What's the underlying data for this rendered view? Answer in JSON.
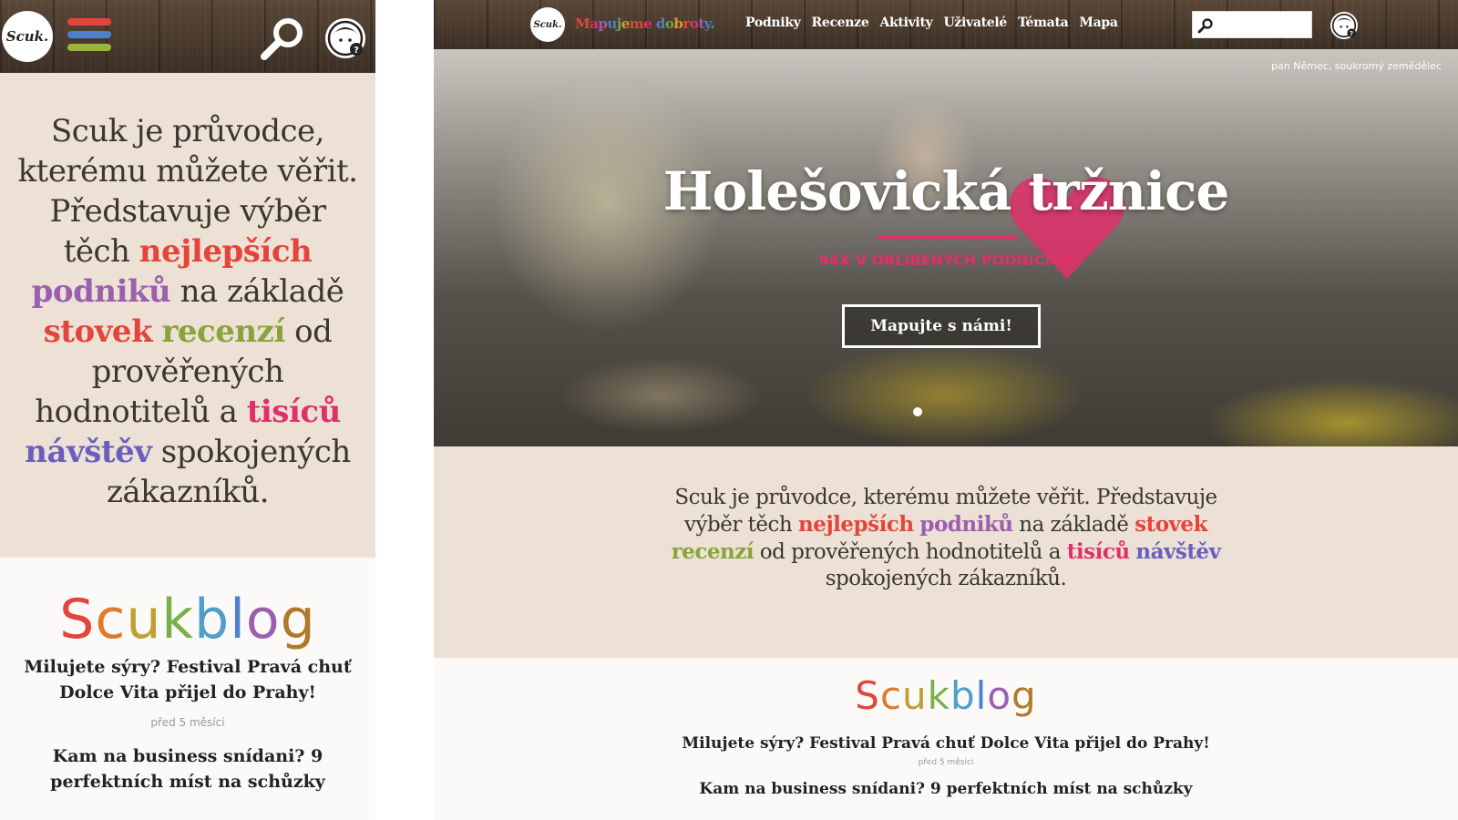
{
  "brand": {
    "logo_text": "Scuk.",
    "tagline": "Mapujeme dobroty.",
    "tagline_colors": [
      "#e4453a",
      "#e0306a",
      "#9b5fb0",
      "#4f7fc8",
      "#6aa84f",
      "#e09a2a"
    ]
  },
  "colors": {
    "intro_bg": "#ece1d4",
    "header_wood": "#4a3a2e",
    "accent_pink": "#e0306a",
    "burger": [
      "#e4453a",
      "#4f7fc8",
      "#9ab53a"
    ]
  },
  "nav": {
    "items": [
      "Podniky",
      "Recenze",
      "Aktivity",
      "Uživatelé",
      "Témata",
      "Mapa"
    ]
  },
  "search": {
    "icon": "magnifier-icon",
    "value": ""
  },
  "help": {
    "icon": "avatar-help-icon"
  },
  "mobile_menu": {
    "icon": "hamburger-menu-icon"
  },
  "hero": {
    "credit": "pan Němec, soukromý zemědělec",
    "title": "Holešovická tržnice",
    "subtitle": "94X V OBLÍBENÝCH PODNICÍCH",
    "button": "Mapujte s námi!",
    "heart_icon": "heart-icon"
  },
  "intro": {
    "text_start": "Scuk je průvodce, kterému můžete věřit. Představuje výběr těch",
    "w1": "nejlepších",
    "w2": "podniků",
    "text_mid1": "na základě",
    "w3": "stovek",
    "w4": "recenzí",
    "text_mid2": "od prověřených hodnotitelů a",
    "w5": "tisíců",
    "w6": "návštěv",
    "text_end": "spokojených zákazníků.",
    "word_colors": [
      "#e4453a",
      "#9b5fb0",
      "#e4453a",
      "#8aa33a",
      "#e0306a",
      "#6a5fc0"
    ]
  },
  "blog": {
    "brand": "Scukblog",
    "brand_letter_colors": [
      "#e4453a",
      "#e07a2a",
      "#c0a030",
      "#7ab04a",
      "#4f9fc8",
      "#4f7fc8",
      "#9b5fb0",
      "#b07a2a"
    ],
    "posts": [
      {
        "title": "Milujete sýry? Festival Pravá chuť Dolce Vita přijel do Prahy!",
        "time": "před 5 měsíci"
      },
      {
        "title": "Kam na business snídani? 9 perfektních míst na schůzky",
        "time": ""
      }
    ]
  }
}
